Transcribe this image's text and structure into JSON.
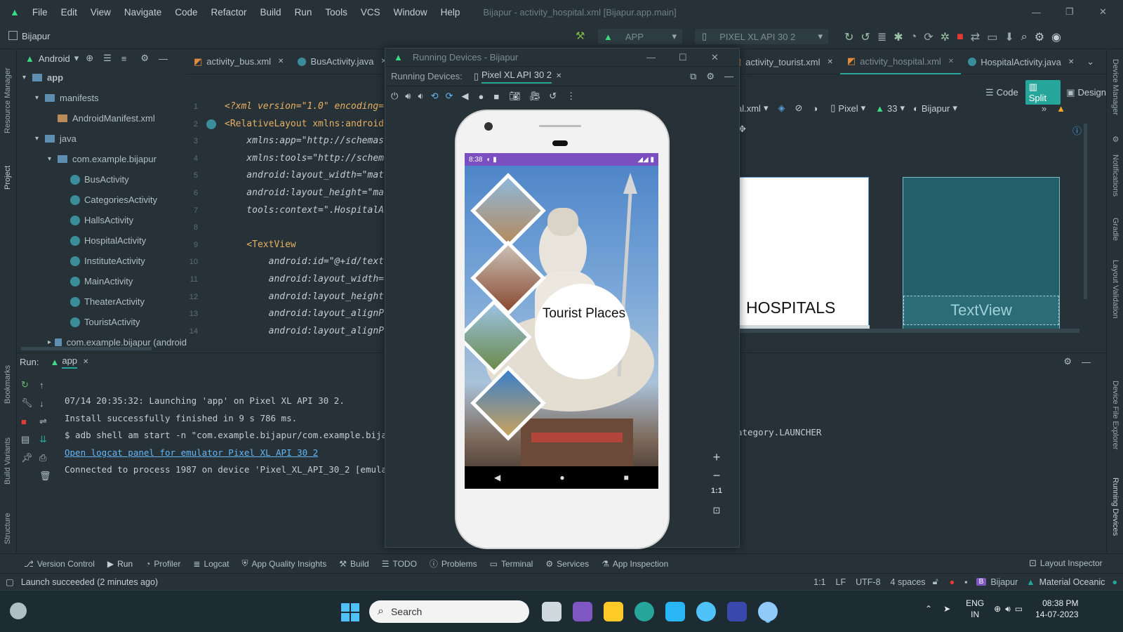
{
  "titlebar": {
    "menu": [
      "File",
      "Edit",
      "View",
      "Navigate",
      "Code",
      "Refactor",
      "Build",
      "Run",
      "Tools",
      "VCS",
      "Window",
      "Help"
    ],
    "window_title": "Bijapur - activity_hospital.xml [Bijapur.app.main]"
  },
  "toolbar": {
    "project_name": "Bijapur",
    "run_config": "APP",
    "device": "PIXEL XL API 30 2"
  },
  "project_panel": {
    "view_mode": "Android",
    "items": [
      {
        "label": "app",
        "indent": 0,
        "type": "folder"
      },
      {
        "label": "manifests",
        "indent": 1,
        "type": "folder"
      },
      {
        "label": "AndroidManifest.xml",
        "indent": 2,
        "type": "file"
      },
      {
        "label": "java",
        "indent": 1,
        "type": "folder"
      },
      {
        "label": "com.example.bijapur",
        "indent": 2,
        "type": "folder"
      },
      {
        "label": "BusActivity",
        "indent": 3,
        "type": "class"
      },
      {
        "label": "CategoriesActivity",
        "indent": 3,
        "type": "class"
      },
      {
        "label": "HallsActivity",
        "indent": 3,
        "type": "class"
      },
      {
        "label": "HospitalActivity",
        "indent": 3,
        "type": "class"
      },
      {
        "label": "InstituteActivity",
        "indent": 3,
        "type": "class"
      },
      {
        "label": "MainActivity",
        "indent": 3,
        "type": "class"
      },
      {
        "label": "TheaterActivity",
        "indent": 3,
        "type": "class"
      },
      {
        "label": "TouristActivity",
        "indent": 3,
        "type": "class"
      },
      {
        "label": "com.example.bijapur (android",
        "indent": 2,
        "type": "folder"
      }
    ]
  },
  "editor_tabs_left": [
    "activity_bus.xml",
    "BusActivity.java"
  ],
  "editor_tabs_right": [
    "activity_tourist.xml",
    "activity_hospital.xml",
    "HospitalActivity.java"
  ],
  "code_lines": [
    {
      "n": "1",
      "text": "<?xml version=\"1.0\" encoding="
    },
    {
      "n": "2",
      "text": "<RelativeLayout xmlns:android"
    },
    {
      "n": "3",
      "text": "    xmlns:app=\"http://schemas"
    },
    {
      "n": "4",
      "text": "    xmlns:tools=\"http://schem"
    },
    {
      "n": "5",
      "text": "    android:layout_width=\"mat"
    },
    {
      "n": "6",
      "text": "    android:layout_height=\"ma"
    },
    {
      "n": "7",
      "text": "    tools:context=\".HospitalA"
    },
    {
      "n": "8",
      "text": ""
    },
    {
      "n": "9",
      "text": "    <TextView"
    },
    {
      "n": "10",
      "text": "        android:id=\"@+id/text"
    },
    {
      "n": "11",
      "text": "        android:layout_width="
    },
    {
      "n": "12",
      "text": "        android:layout_height"
    },
    {
      "n": "13",
      "text": "        android:layout_alignP"
    },
    {
      "n": "14",
      "text": "        android:layout_alignP"
    }
  ],
  "design_toolbar": {
    "code_label": "Code",
    "split_label": "Split",
    "design_label": "Design",
    "file_suffix": "al.xml",
    "device": "Pixel",
    "api": "33",
    "theme": "Bijapur"
  },
  "preview": {
    "hospitals_label": "HOSPITALS",
    "textview_label": "TextView"
  },
  "running_devices": {
    "window_title": "Running Devices - Bijapur",
    "tab_prefix": "Running Devices:",
    "device_tab": "Pixel XL API 30 2",
    "zoom_label": "1:1"
  },
  "phone": {
    "time": "8:38",
    "center_label": "Tourist Places"
  },
  "run_panel": {
    "label": "Run:",
    "tab": "app",
    "lines": [
      "07/14 20:35:32: Launching 'app' on Pixel XL API 30 2.",
      "Install successfully finished in 9 s 786 ms.",
      "$ adb shell am start -n \"com.example.bijapur/com.example.bija"
    ],
    "link": "Open logcat panel for emulator Pixel XL API 30 2",
    "last_line": "Connected to process 1987 on device 'Pixel_XL_API_30_2 [emula",
    "tail_text": "ategory.LAUNCHER"
  },
  "bottom_tools": [
    "Version Control",
    "Run",
    "Profiler",
    "Logcat",
    "App Quality Insights",
    "Build",
    "TODO",
    "Problems",
    "Terminal",
    "Services",
    "App Inspection"
  ],
  "layout_inspector": "Layout Inspector",
  "status": {
    "message": "Launch succeeded (2 minutes ago)",
    "pos": "1:1",
    "lf": "LF",
    "encoding": "UTF-8",
    "indent": "4 spaces",
    "project": "Bijapur",
    "theme": "Material Oceanic"
  },
  "left_strip": [
    "Resource Manager",
    "Project",
    "Bookmarks",
    "Build Variants",
    "Structure"
  ],
  "right_strip": [
    "Device Manager",
    "Notifications",
    "Gradle",
    "Layout Validation",
    "Device File Explorer",
    "Running Devices"
  ],
  "taskbar": {
    "search_placeholder": "Search",
    "lang": "ENG",
    "region": "IN",
    "time": "08:38 PM",
    "date": "14-07-2023"
  },
  "colors": {
    "accent": "#26a69a",
    "bg": "#263238",
    "phone_status": "#7b4fbf"
  }
}
